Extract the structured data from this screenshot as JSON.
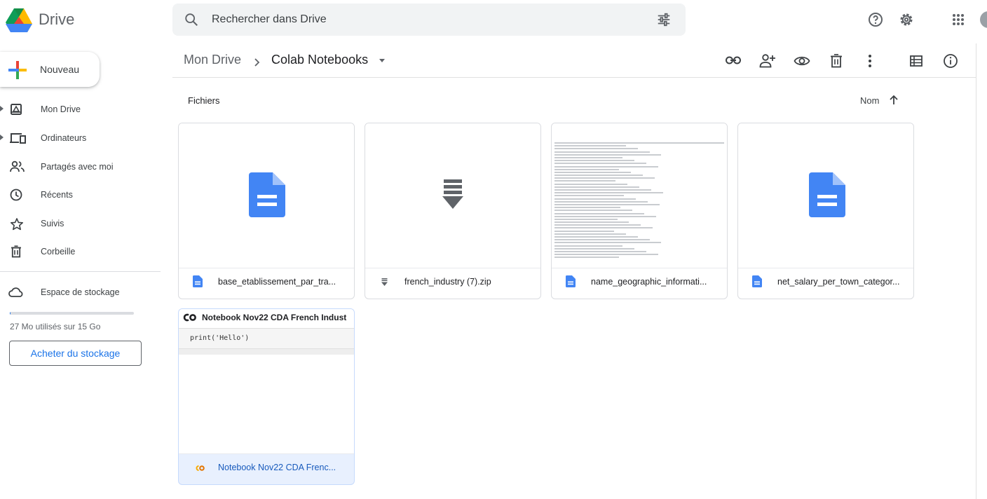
{
  "app": {
    "name": "Drive"
  },
  "search": {
    "placeholder": "Rechercher dans Drive"
  },
  "topbar": {
    "icons": [
      "help-icon",
      "settings-icon",
      "apps-grid-icon",
      "account-avatar"
    ]
  },
  "new_button": {
    "label": "Nouveau"
  },
  "sidebar": {
    "items": [
      {
        "label": "Mon Drive",
        "icon": "my-drive-icon",
        "expandable": true
      },
      {
        "label": "Ordinateurs",
        "icon": "computers-icon",
        "expandable": true
      },
      {
        "label": "Partagés avec moi",
        "icon": "shared-icon",
        "expandable": false
      },
      {
        "label": "Récents",
        "icon": "clock-icon",
        "expandable": false
      },
      {
        "label": "Suivis",
        "icon": "star-icon",
        "expandable": false
      },
      {
        "label": "Corbeille",
        "icon": "trash-icon",
        "expandable": false
      }
    ],
    "storage": {
      "label": "Espace de stockage",
      "usage_text": "27 Mo utilisés sur 15 Go",
      "used_fraction": 0.0018,
      "buy_label": "Acheter du stockage"
    }
  },
  "breadcrumb": {
    "root": "Mon Drive",
    "current": "Colab Notebooks"
  },
  "actions": [
    "link-icon",
    "add-person-icon",
    "preview-icon",
    "trash-icon",
    "more-icon",
    "list-view-icon",
    "info-icon"
  ],
  "files_section": {
    "label": "Fichiers",
    "sort_label": "Nom"
  },
  "files": [
    {
      "name": "base_etablissement_par_tra...",
      "type": "doc"
    },
    {
      "name": "french_industry (7).zip",
      "type": "zip"
    },
    {
      "name": "name_geographic_informati...",
      "type": "doc"
    },
    {
      "name": "net_salary_per_town_categor...",
      "type": "doc"
    },
    {
      "name": "Notebook Nov22 CDA Frenc...",
      "type": "colab",
      "preview_title": "Notebook Nov22 CDA French Indust",
      "preview_code": "print('Hello')"
    }
  ],
  "colors": {
    "accent": "#1a73e8",
    "doc_blue": "#4285f4",
    "selected_bg": "#e8f0fe",
    "colab_orange": "#f9ab00"
  }
}
